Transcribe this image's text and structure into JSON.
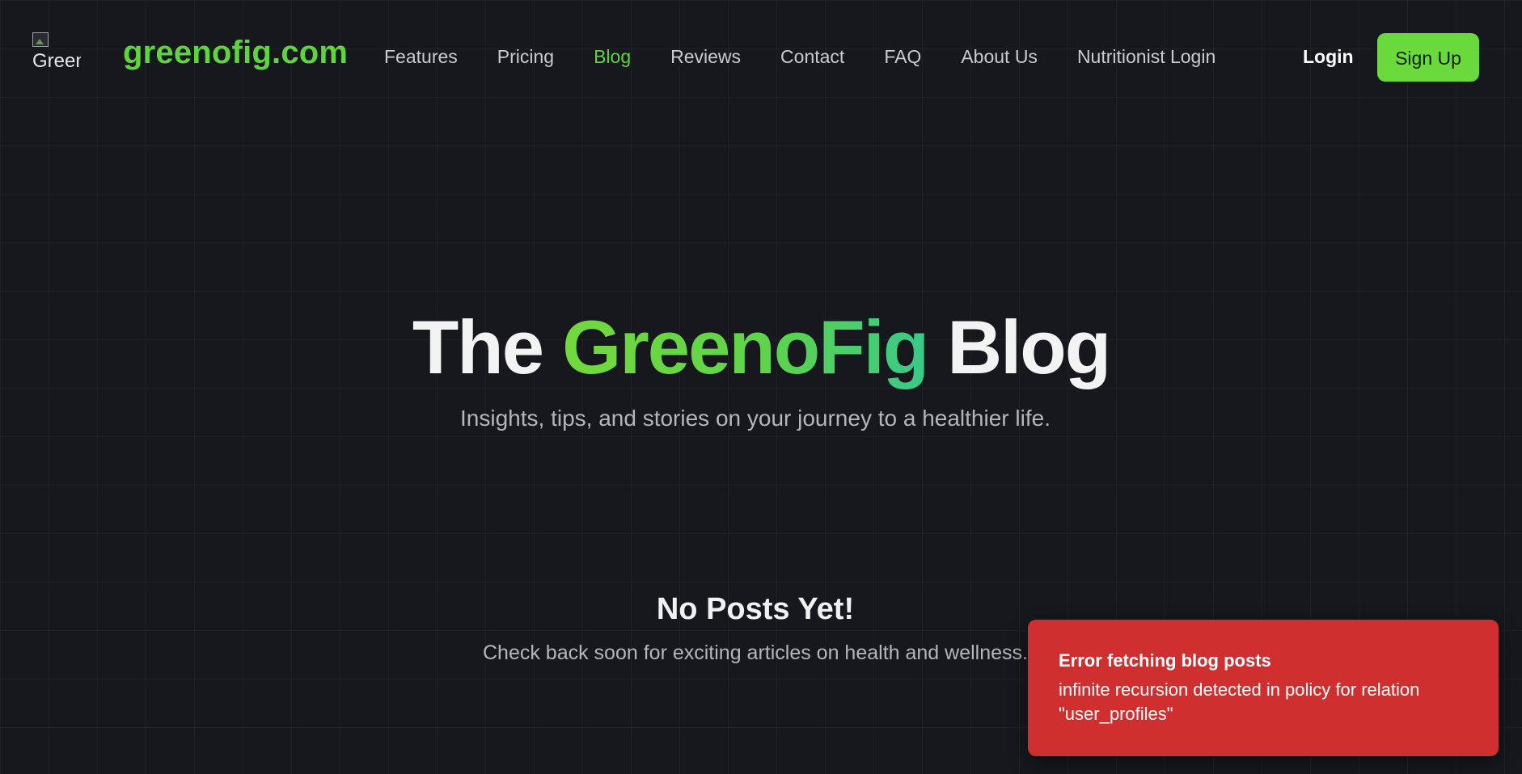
{
  "header": {
    "logo_alt": "Greenofig logo",
    "logo_text": "greenofig.com",
    "nav": [
      {
        "label": "Features",
        "active": false
      },
      {
        "label": "Pricing",
        "active": false
      },
      {
        "label": "Blog",
        "active": true
      },
      {
        "label": "Reviews",
        "active": false
      },
      {
        "label": "Contact",
        "active": false
      },
      {
        "label": "FAQ",
        "active": false
      },
      {
        "label": "About Us",
        "active": false
      },
      {
        "label": "Nutritionist Login",
        "active": false
      }
    ],
    "login_label": "Login",
    "signup_label": "Sign Up"
  },
  "hero": {
    "title_before": "The ",
    "title_accent": "GreenoFig",
    "title_after": " Blog",
    "subtitle": "Insights, tips, and stories on your journey to a healthier life."
  },
  "empty_state": {
    "title": "No Posts Yet!",
    "subtitle": "Check back soon for exciting articles on health and wellness."
  },
  "toast": {
    "title": "Error fetching blog posts",
    "description": "infinite recursion detected in policy for relation \"user_profiles\""
  },
  "colors": {
    "background": "#17181d",
    "accent_green": "#62d340",
    "signup_bg": "#6ad93b",
    "toast_bg": "#d02f2f"
  }
}
